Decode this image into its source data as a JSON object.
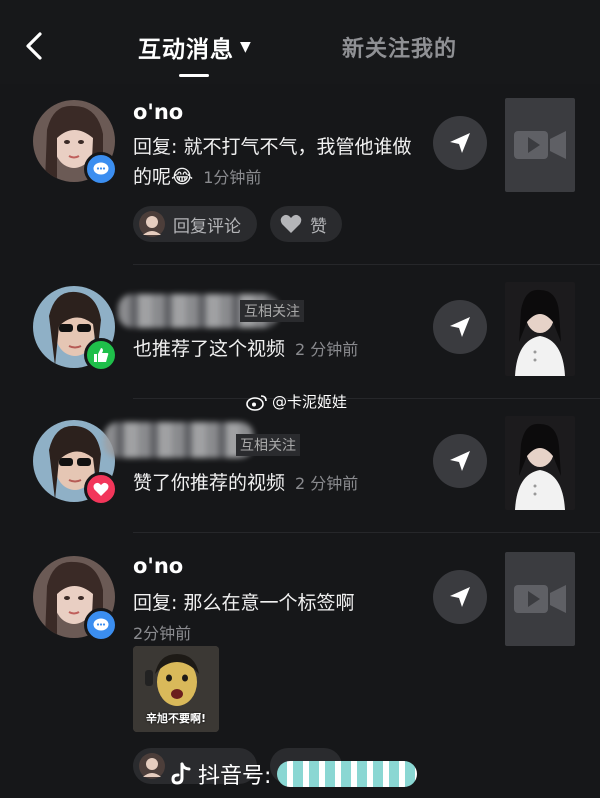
{
  "header": {
    "tab_active": "互动消息",
    "tab_inactive": "新关注我的"
  },
  "items": [
    {
      "name": "o'no",
      "message": "回复: 就不打气不气，我管他谁做的呢😂",
      "time": "1分钟前",
      "reply_label": "回复评论",
      "like_label": "赞"
    },
    {
      "tag": "互相关注",
      "message": "也推荐了这个视频",
      "time": "2 分钟前"
    },
    {
      "tag": "互相关注",
      "message": "赞了你推荐的视频",
      "time": "2 分钟前"
    },
    {
      "name": "o'no",
      "message": "回复: 那么在意一个标签啊",
      "time": "2分钟前",
      "sticker_caption": "辛旭不要啊!"
    }
  ],
  "watermark": "@卡泥姬娃",
  "douyin_id_label": "抖音号:",
  "colors": {
    "background": "#161719",
    "comment_badge": "#3b8ef0",
    "like_badge": "#1fbf4a",
    "heart_badge": "#f2365a"
  },
  "icons": [
    "back-arrow-icon",
    "share-icon",
    "video-icon",
    "comment-badge-icon",
    "like-badge-icon",
    "heart-badge-icon",
    "heart-icon",
    "weibo-icon",
    "douyin-logo-icon"
  ]
}
